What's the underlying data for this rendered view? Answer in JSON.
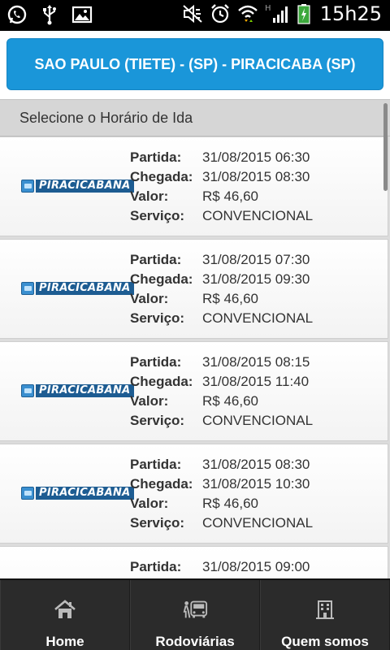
{
  "status_bar": {
    "time": "15h25",
    "left_icons": [
      "whatsapp-icon",
      "usb-icon",
      "image-icon"
    ],
    "right_icons": [
      "mute-icon",
      "alarm-icon",
      "wifi-icon",
      "signal-icon",
      "battery-icon"
    ],
    "network_badge": "H"
  },
  "route": {
    "title": "SAO PAULO (TIETE) - (SP) - PIRACICABA (SP)"
  },
  "section": {
    "title": "Selecione o Horário de Ida"
  },
  "labels": {
    "partida": "Partida:",
    "chegada": "Chegada:",
    "valor": "Valor:",
    "servico": "Serviço:"
  },
  "trips": [
    {
      "company": "PIRACICABANA",
      "partida": "31/08/2015 06:30",
      "chegada": "31/08/2015 08:30",
      "valor": "R$ 46,60",
      "servico": "CONVENCIONAL"
    },
    {
      "company": "PIRACICABANA",
      "partida": "31/08/2015 07:30",
      "chegada": "31/08/2015 09:30",
      "valor": "R$ 46,60",
      "servico": "CONVENCIONAL"
    },
    {
      "company": "PIRACICABANA",
      "partida": "31/08/2015 08:15",
      "chegada": "31/08/2015 11:40",
      "valor": "R$ 46,60",
      "servico": "CONVENCIONAL"
    },
    {
      "company": "PIRACICABANA",
      "partida": "31/08/2015 08:30",
      "chegada": "31/08/2015 10:30",
      "valor": "R$ 46,60",
      "servico": "CONVENCIONAL"
    },
    {
      "company": "",
      "partida": "31/08/2015 09:00",
      "chegada": "",
      "valor": "",
      "servico": ""
    }
  ],
  "nav": {
    "home": "Home",
    "rodoviarias": "Rodoviárias",
    "quem_somos": "Quem somos"
  },
  "colors": {
    "accent": "#1a96d9",
    "logo_blue": "#1d5c92",
    "nav_bg": "#2b2b2b"
  }
}
